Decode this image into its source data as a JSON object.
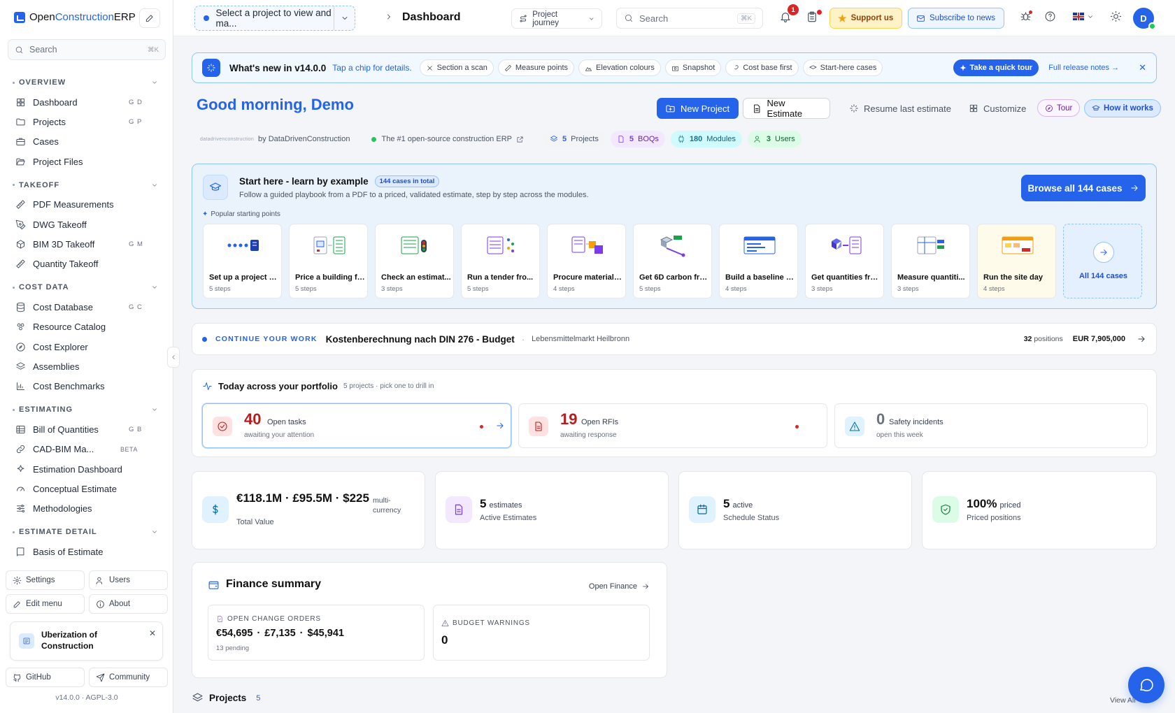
{
  "brand": {
    "name_pre": "Open",
    "name_mid": "Construction",
    "name_post": "ERP"
  },
  "sidebar": {
    "search_placeholder": "Search",
    "search_kbd": "⌘K",
    "sections": [
      {
        "label": "OVERVIEW",
        "items": [
          {
            "label": "Dashboard",
            "shortcut": "G D",
            "icon": "layout-icon"
          },
          {
            "label": "Projects",
            "shortcut": "G P",
            "icon": "folder-icon"
          },
          {
            "label": "Cases",
            "shortcut": "",
            "icon": "briefcase-icon"
          },
          {
            "label": "Project Files",
            "shortcut": "",
            "icon": "folder-open-icon"
          }
        ]
      },
      {
        "label": "TAKEOFF",
        "items": [
          {
            "label": "PDF Measurements",
            "shortcut": "",
            "icon": "ruler-icon"
          },
          {
            "label": "DWG Takeoff",
            "shortcut": "",
            "icon": "pen-tool-icon"
          },
          {
            "label": "BIM 3D Takeoff",
            "shortcut": "G M",
            "icon": "cube-icon"
          },
          {
            "label": "Quantity Takeoff",
            "shortcut": "",
            "icon": "ruler-icon"
          }
        ]
      },
      {
        "label": "COST DATA",
        "items": [
          {
            "label": "Cost Database",
            "shortcut": "G C",
            "icon": "database-icon"
          },
          {
            "label": "Resource Catalog",
            "shortcut": "",
            "icon": "boxes-icon"
          },
          {
            "label": "Cost Explorer",
            "shortcut": "",
            "icon": "compass-icon"
          },
          {
            "label": "Assemblies",
            "shortcut": "",
            "icon": "layers-icon"
          },
          {
            "label": "Cost Benchmarks",
            "shortcut": "",
            "icon": "bar-chart-icon"
          }
        ]
      },
      {
        "label": "ESTIMATING",
        "items": [
          {
            "label": "Bill of Quantities",
            "shortcut": "G B",
            "icon": "table-icon"
          },
          {
            "label": "CAD-BIM Ma...",
            "shortcut": "",
            "beta": "BETA",
            "icon": "link-icon"
          },
          {
            "label": "Estimation Dashboard",
            "shortcut": "",
            "icon": "sparkles-icon"
          },
          {
            "label": "Conceptual Estimate",
            "shortcut": "",
            "icon": "gauge-icon"
          },
          {
            "label": "Methodologies",
            "shortcut": "",
            "icon": "sliders-icon"
          }
        ]
      },
      {
        "label": "ESTIMATE DETAIL",
        "items": [
          {
            "label": "Basis of Estimate",
            "shortcut": "",
            "icon": "book-icon"
          }
        ]
      }
    ],
    "bottom": {
      "settings": "Settings",
      "users": "Users",
      "edit_menu": "Edit menu",
      "about": "About",
      "github": "GitHub",
      "community": "Community"
    },
    "promo": "Uberization of Construction",
    "version": "v14.0.0 · AGPL-3.0"
  },
  "topbar": {
    "project_select": "Select a project to view and ma...",
    "breadcrumb": "Dashboard",
    "journey": "Project journey",
    "search_placeholder": "Search",
    "search_kbd": "⌘K",
    "notif_count": "1",
    "support": "Support us",
    "subscribe": "Subscribe to news",
    "avatar": "D"
  },
  "whatsnew": {
    "title": "What's new in v14.0.0",
    "subtitle": "Tap a chip for details.",
    "chips": [
      "Section a scan",
      "Measure points",
      "Elevation colours",
      "Snapshot",
      "Cost base first",
      "Start-here cases"
    ],
    "tour": "Take a quick tour",
    "release_notes": "Full release notes →"
  },
  "greeting": "Good morning, Demo",
  "actions": {
    "new_project": "New Project",
    "new_estimate": "New Estimate",
    "resume": "Resume last estimate",
    "customize": "Customize",
    "tour": "Tour",
    "how": "How it works"
  },
  "meta": {
    "logo_text": "datadrivenconstruction",
    "by": "by DataDrivenConstruction",
    "tagline": "The #1 open-source construction ERP",
    "stats": [
      {
        "value": "5",
        "label": "Projects"
      },
      {
        "value": "5",
        "label": "BOQs"
      },
      {
        "value": "180",
        "label": "Modules"
      },
      {
        "value": "3",
        "label": "Users"
      }
    ]
  },
  "start_here": {
    "title": "Start here - learn by example",
    "badge": "144 cases in total",
    "description": "Follow a guided playbook from a PDF to a priced, validated estimate, step by step across the modules.",
    "browse": "Browse all 144 cases",
    "popular": "Popular starting points",
    "cards": [
      {
        "title": "Set up a project a...",
        "steps": "5 steps"
      },
      {
        "title": "Price a building fr...",
        "steps": "5 steps"
      },
      {
        "title": "Check an estimat...",
        "steps": "3 steps"
      },
      {
        "title": "Run a tender fro...",
        "steps": "5 steps"
      },
      {
        "title": "Procure materials...",
        "steps": "4 steps"
      },
      {
        "title": "Get 6D carbon fro...",
        "steps": "5 steps"
      },
      {
        "title": "Build a baseline a...",
        "steps": "4 steps"
      },
      {
        "title": "Get quantities fro...",
        "steps": "3 steps"
      },
      {
        "title": "Measure quantiti...",
        "steps": "3 steps"
      },
      {
        "title": "Run the site day",
        "steps": "4 steps"
      }
    ],
    "all": "All 144 cases"
  },
  "continue": {
    "label": "CONTINUE YOUR WORK",
    "title": "Kostenberechnung nach DIN 276 - Budget",
    "project": "Lebensmittelmarkt Heilbronn",
    "positions_num": "32",
    "positions_label": "positions",
    "amount": "EUR 7,905,000"
  },
  "today": {
    "title": "Today across your portfolio",
    "subtitle": "5 projects · pick one to drill in",
    "cards": [
      {
        "value": "40",
        "label": "Open tasks",
        "sub": "awaiting your attention"
      },
      {
        "value": "19",
        "label": "Open RFIs",
        "sub": "awaiting response"
      },
      {
        "value": "0",
        "label": "Safety incidents",
        "sub": "open this week"
      }
    ]
  },
  "kpis": [
    {
      "value": "€118.1M · £95.5M · $225...",
      "unit": "multi-currency",
      "label": "Total Value"
    },
    {
      "value": "5",
      "unit": "estimates",
      "label": "Active Estimates"
    },
    {
      "value": "5",
      "unit": "active",
      "label": "Schedule Status"
    },
    {
      "value": "100%",
      "unit": "priced",
      "label": "Priced positions"
    }
  ],
  "finance": {
    "title": "Finance summary",
    "open": "Open Finance",
    "change_orders_label": "OPEN CHANGE ORDERS",
    "change_orders_value": "€54,695 · £7,135 · $45,941",
    "change_orders_sub": "13 pending",
    "budget_label": "BUDGET WARNINGS",
    "budget_value": "0"
  },
  "projects": {
    "title": "Projects",
    "count": "5",
    "view_all": "View All"
  },
  "colors": {
    "accent": "#2563eb",
    "danger": "#dc2626",
    "success": "#22c55e"
  }
}
